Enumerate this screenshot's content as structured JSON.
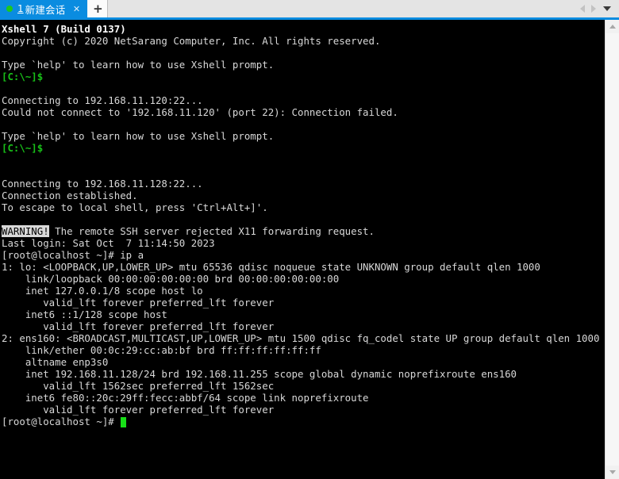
{
  "window": {
    "tab": {
      "index": "1",
      "title": "新建会话",
      "close_label": "✕",
      "status_dot_color": "#1ec81e",
      "active_color": "#0a8ce0"
    },
    "new_tab_label": "+",
    "nav": {
      "prev_label": "",
      "next_label": "",
      "menu_label": ""
    }
  },
  "terminal": {
    "background": "#000000",
    "foreground": "#d8d8d8",
    "prompt_color": "#18c018",
    "cursor_color": "#18e018",
    "lines": [
      {
        "kind": "bold",
        "text": "Xshell 7 (Build 0137)"
      },
      {
        "kind": "plain",
        "text": "Copyright (c) 2020 NetSarang Computer, Inc. All rights reserved."
      },
      {
        "kind": "blank",
        "text": ""
      },
      {
        "kind": "plain",
        "text": "Type `help' to learn how to use Xshell prompt."
      },
      {
        "kind": "green",
        "text": "[C:\\~]$"
      },
      {
        "kind": "blank",
        "text": ""
      },
      {
        "kind": "plain",
        "text": "Connecting to 192.168.11.120:22..."
      },
      {
        "kind": "plain",
        "text": "Could not connect to '192.168.11.120' (port 22): Connection failed."
      },
      {
        "kind": "blank",
        "text": ""
      },
      {
        "kind": "plain",
        "text": "Type `help' to learn how to use Xshell prompt."
      },
      {
        "kind": "green",
        "text": "[C:\\~]$"
      },
      {
        "kind": "blank",
        "text": ""
      },
      {
        "kind": "blank",
        "text": ""
      },
      {
        "kind": "plain",
        "text": "Connecting to 192.168.11.128:22..."
      },
      {
        "kind": "plain",
        "text": "Connection established."
      },
      {
        "kind": "plain",
        "text": "To escape to local shell, press 'Ctrl+Alt+]'."
      },
      {
        "kind": "blank",
        "text": ""
      },
      {
        "kind": "warning",
        "highlight": "WARNING!",
        "text": " The remote SSH server rejected X11 forwarding request."
      },
      {
        "kind": "plain",
        "text": "Last login: Sat Oct  7 11:14:50 2023"
      },
      {
        "kind": "plain",
        "text": "[root@localhost ~]# ip a"
      },
      {
        "kind": "plain",
        "text": "1: lo: <LOOPBACK,UP,LOWER_UP> mtu 65536 qdisc noqueue state UNKNOWN group default qlen 1000"
      },
      {
        "kind": "plain",
        "text": "    link/loopback 00:00:00:00:00:00 brd 00:00:00:00:00:00"
      },
      {
        "kind": "plain",
        "text": "    inet 127.0.0.1/8 scope host lo"
      },
      {
        "kind": "plain",
        "text": "       valid_lft forever preferred_lft forever"
      },
      {
        "kind": "plain",
        "text": "    inet6 ::1/128 scope host"
      },
      {
        "kind": "plain",
        "text": "       valid_lft forever preferred_lft forever"
      },
      {
        "kind": "plain",
        "text": "2: ens160: <BROADCAST,MULTICAST,UP,LOWER_UP> mtu 1500 qdisc fq_codel state UP group default qlen 1000"
      },
      {
        "kind": "plain",
        "text": "    link/ether 00:0c:29:cc:ab:bf brd ff:ff:ff:ff:ff:ff"
      },
      {
        "kind": "plain",
        "text": "    altname enp3s0"
      },
      {
        "kind": "plain",
        "text": "    inet 192.168.11.128/24 brd 192.168.11.255 scope global dynamic noprefixroute ens160"
      },
      {
        "kind": "plain",
        "text": "       valid_lft 1562sec preferred_lft 1562sec"
      },
      {
        "kind": "plain",
        "text": "    inet6 fe80::20c:29ff:fecc:abbf/64 scope link noprefixroute"
      },
      {
        "kind": "plain",
        "text": "       valid_lft forever preferred_lft forever"
      },
      {
        "kind": "cursorline",
        "text": "[root@localhost ~]# "
      }
    ]
  }
}
